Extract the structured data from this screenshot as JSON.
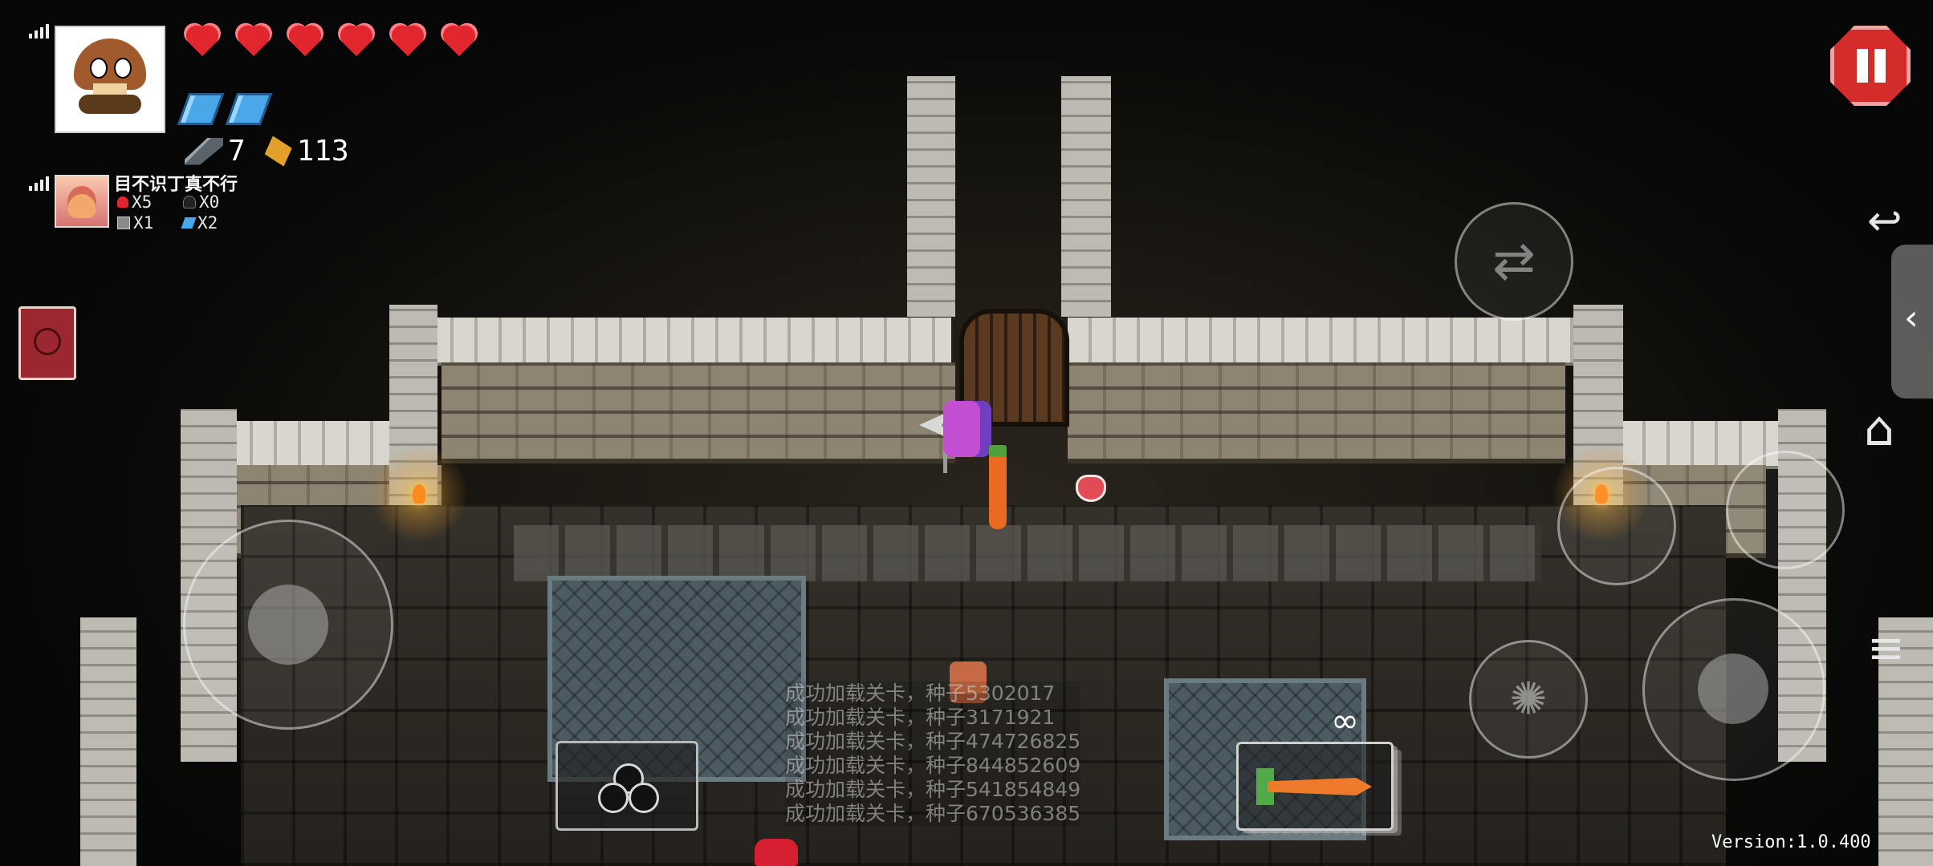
{
  "game": {
    "player1": {
      "avatar": "goomba-avatar",
      "health_hearts": 6,
      "shields": 2,
      "weapon_ammo": "7",
      "bullets": "113"
    },
    "player2": {
      "name": "目不识丁真不行",
      "stats": [
        {
          "icon": "heart-icon",
          "text": "X5"
        },
        {
          "icon": "black-heart-icon",
          "text": "X0"
        },
        {
          "icon": "armor-icon",
          "text": "X1"
        },
        {
          "icon": "shield-gem-icon",
          "text": "X2"
        }
      ]
    },
    "log_lines": [
      "成功加载关卡，种子5302017",
      "成功加载关卡，种子3171921",
      "成功加载关卡，种子474726825",
      "成功加载关卡，种子844852609",
      "成功加载关卡，种子541854849",
      "成功加载关卡，种子670536385"
    ],
    "weapon_ammo_symbol": "∞",
    "version": "Version:1.0.400"
  },
  "controls": {
    "left_joystick": "movement-joystick",
    "swap": "swap-weapon-icon",
    "skill": "skill-icon",
    "attack": "attack-joystick",
    "emote": "emote-icon",
    "item": "club-card-icon"
  },
  "system_nav": {
    "back": "↩",
    "home": "⌂",
    "menu": "≡",
    "side_tab": "‹"
  },
  "colors": {
    "heart": "#e1262e",
    "shield": "#4aa8e8",
    "pause": "#d42b2b"
  }
}
